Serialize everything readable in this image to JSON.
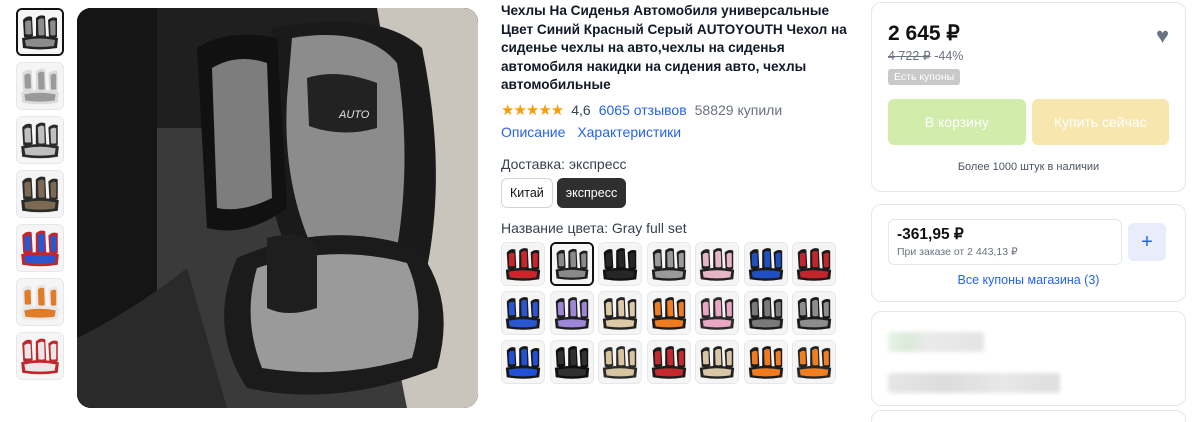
{
  "product": {
    "title": "Чехлы На Сиденья Автомобиля универсальные Цвет Синий Красный Серый AUTOYOUTH Чехол на сиденье чехлы на авто,чехлы на сиденья автомобиля накидки на сидения авто, чехлы автомобильные",
    "stars": "★★★★★",
    "rating": "4,6",
    "reviews": "6065 отзывов",
    "sold": "58829 купили"
  },
  "links": {
    "description": "Описание",
    "specs": "Характеристики"
  },
  "delivery": {
    "label": "Доставка: экспресс",
    "options": [
      "Китай",
      "экспресс"
    ],
    "selected": 1
  },
  "color": {
    "label": "Название цвета: Gray full set",
    "selected_index": 1,
    "swatches": [
      {
        "primary": "#c8262b",
        "secondary": "#1a1a1a"
      },
      {
        "primary": "#8a8a8a",
        "secondary": "#1f1f1f"
      },
      {
        "primary": "#262626",
        "secondary": "#111111"
      },
      {
        "primary": "#9a9a9a",
        "secondary": "#1e1e1e"
      },
      {
        "primary": "#e8b4c8",
        "secondary": "#222222"
      },
      {
        "primary": "#1f4fc0",
        "secondary": "#1a1a1a"
      },
      {
        "primary": "#c0262b",
        "secondary": "#1b1b1b"
      },
      {
        "primary": "#2a56d0",
        "secondary": "#1a1a1a"
      },
      {
        "primary": "#9e86d6",
        "secondary": "#1e1e1e"
      },
      {
        "primary": "#dcc9a6",
        "secondary": "#222222"
      },
      {
        "primary": "#f07c22",
        "secondary": "#1c1c1c"
      },
      {
        "primary": "#e8a8c4",
        "secondary": "#2a2a2a"
      },
      {
        "primary": "#7a7a7a",
        "secondary": "#1c1c1c"
      },
      {
        "primary": "#8d8d8d",
        "secondary": "#1b1b1b"
      },
      {
        "primary": "#2050d8",
        "secondary": "#161616"
      },
      {
        "primary": "#303030",
        "secondary": "#0f0f0f"
      },
      {
        "primary": "#d9c4a0",
        "secondary": "#2b2b2b"
      },
      {
        "primary": "#c42a2d",
        "secondary": "#1c1c1c"
      },
      {
        "primary": "#d8c6a6",
        "secondary": "#232323"
      },
      {
        "primary": "#ef7a20",
        "secondary": "#1c1c1c"
      },
      {
        "primary": "#f07f22",
        "secondary": "#262626"
      }
    ]
  },
  "thumbnails": [
    {
      "primary": "#8c8c8c",
      "secondary": "#222222",
      "selected": true
    },
    {
      "primary": "#9a9a9a",
      "secondary": "#dcdcdc",
      "selected": false
    },
    {
      "primary": "#bfbfbf",
      "secondary": "#2a2a2a",
      "selected": false
    },
    {
      "primary": "#7c6a55",
      "secondary": "#2b2b2b",
      "selected": false
    },
    {
      "primary": "#2a56d0",
      "secondary": "#c0262b",
      "selected": false
    },
    {
      "primary": "#e07b27",
      "secondary": "#e8e8e8",
      "selected": false
    },
    {
      "primary": "#e8e8e8",
      "secondary": "#c0262b",
      "selected": false
    }
  ],
  "buy_box": {
    "price": "2 645 ₽",
    "old_price": "4 722 ₽",
    "discount": "-44%",
    "coupon_tag": "Есть купоны",
    "add_to_cart": "В корзину",
    "buy_now": "Купить сейчас",
    "stock": "Более 1000 штук в наличии"
  },
  "coupon": {
    "amount": "-361,95 ₽",
    "condition": "При заказе от 2 443,13 ₽",
    "store_coupons": "Все купоны магазина (3)"
  },
  "colors": {
    "link": "#2563eb",
    "star": "#f59e0b",
    "cart_button": "#d1ecab",
    "buy_button": "#f7e7ae"
  }
}
